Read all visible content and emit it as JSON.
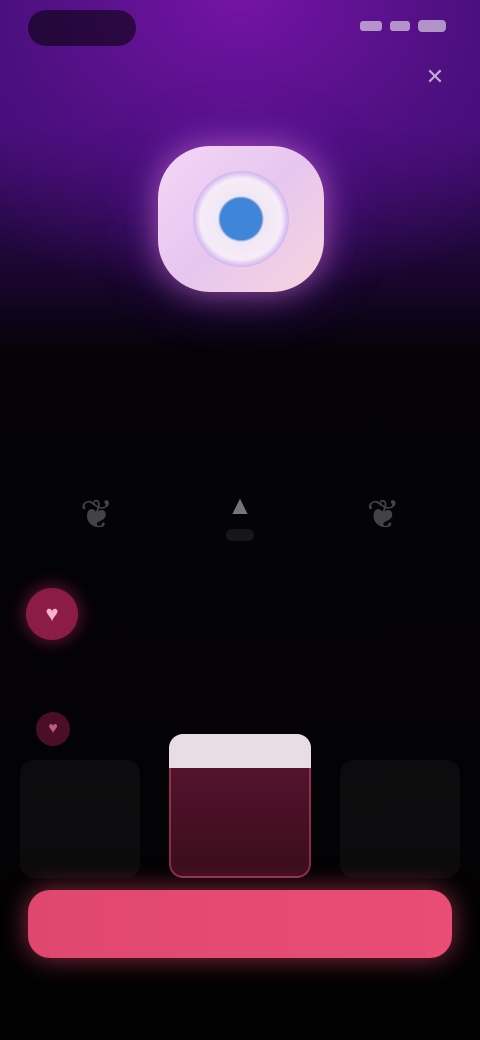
{
  "status_bar": {
    "time": ""
  },
  "close_label": "✕",
  "hero": {
    "title": "",
    "subtitle": ""
  },
  "award": {
    "label": ""
  },
  "feature": {
    "title": "",
    "description": ""
  },
  "plans": [
    {
      "name": "",
      "price": ""
    },
    {
      "name": "",
      "price": "",
      "badge": ""
    },
    {
      "name": "",
      "price": ""
    }
  ],
  "cta_label": "",
  "footer": {
    "link1": "",
    "link2": "",
    "link3": ""
  },
  "colors": {
    "accent": "#e0476e",
    "logo_blue": "#3f86d8",
    "feature_icon_bg": "#8a1c46"
  }
}
